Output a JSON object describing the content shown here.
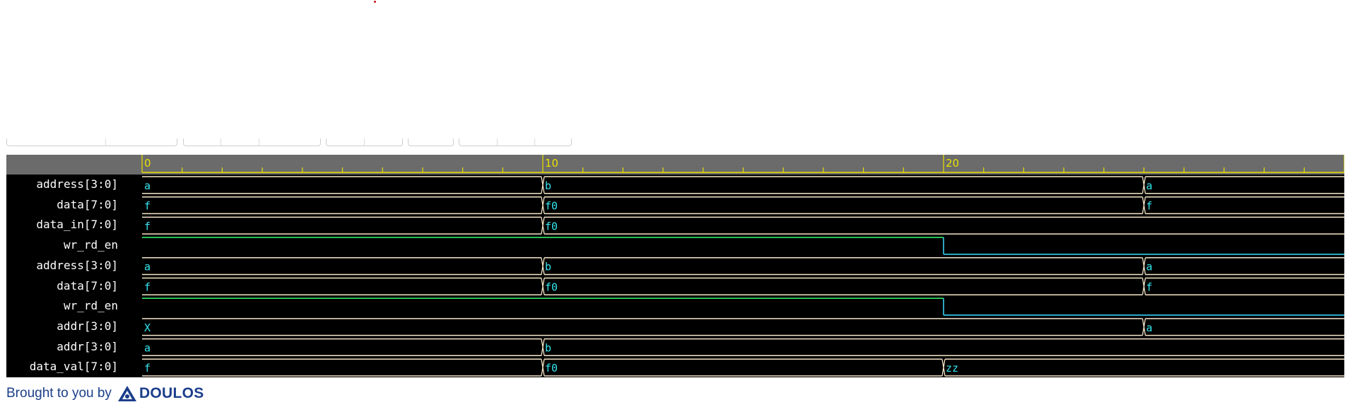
{
  "footer": {
    "brought_text": "Brought to you by",
    "brand": "DOULOS",
    "brand_color": "#1b3e8a"
  },
  "timeline": {
    "t_start": 0,
    "t_end": 30,
    "major_ticks": [
      "0",
      "10",
      "20"
    ],
    "minor_step": 1
  },
  "colors": {
    "background": "#000000",
    "header": "#6b6b6b",
    "ruler": "#e8e000",
    "bus": "#f5e6c8",
    "bus_text": "#35e5f0",
    "signal_high": "#2ee86a",
    "signal_low": "#35d0f0",
    "name_text": "#ffffff"
  },
  "signals": [
    {
      "name": "address[3:0]",
      "type": "bus",
      "segments": [
        {
          "t": 0,
          "v": "a"
        },
        {
          "t": 10,
          "v": "b"
        },
        {
          "t": 25,
          "v": "a"
        }
      ]
    },
    {
      "name": "data[7:0]",
      "type": "bus",
      "segments": [
        {
          "t": 0,
          "v": "f"
        },
        {
          "t": 10,
          "v": "f0"
        },
        {
          "t": 25,
          "v": "f"
        }
      ]
    },
    {
      "name": "data_in[7:0]",
      "type": "bus",
      "segments": [
        {
          "t": 0,
          "v": "f"
        },
        {
          "t": 10,
          "v": "f0"
        }
      ]
    },
    {
      "name": "wr_rd_en",
      "type": "bit",
      "segments": [
        {
          "t": 0,
          "v": "1"
        },
        {
          "t": 20,
          "v": "0"
        }
      ]
    },
    {
      "name": "address[3:0]",
      "type": "bus",
      "segments": [
        {
          "t": 0,
          "v": "a"
        },
        {
          "t": 10,
          "v": "b"
        },
        {
          "t": 25,
          "v": "a"
        }
      ]
    },
    {
      "name": "data[7:0]",
      "type": "bus",
      "segments": [
        {
          "t": 0,
          "v": "f"
        },
        {
          "t": 10,
          "v": "f0"
        },
        {
          "t": 25,
          "v": "f"
        }
      ]
    },
    {
      "name": "wr_rd_en",
      "type": "bit",
      "segments": [
        {
          "t": 0,
          "v": "1"
        },
        {
          "t": 20,
          "v": "0"
        }
      ]
    },
    {
      "name": "addr[3:0]",
      "type": "bus",
      "segments": [
        {
          "t": 0,
          "v": "X"
        },
        {
          "t": 25,
          "v": "a"
        }
      ]
    },
    {
      "name": "addr[3:0]",
      "type": "bus",
      "segments": [
        {
          "t": 0,
          "v": "a"
        },
        {
          "t": 10,
          "v": "b"
        }
      ]
    },
    {
      "name": "data_val[7:0]",
      "type": "bus",
      "segments": [
        {
          "t": 0,
          "v": "f"
        },
        {
          "t": 10,
          "v": "f0"
        },
        {
          "t": 20,
          "v": "zz"
        }
      ]
    }
  ]
}
